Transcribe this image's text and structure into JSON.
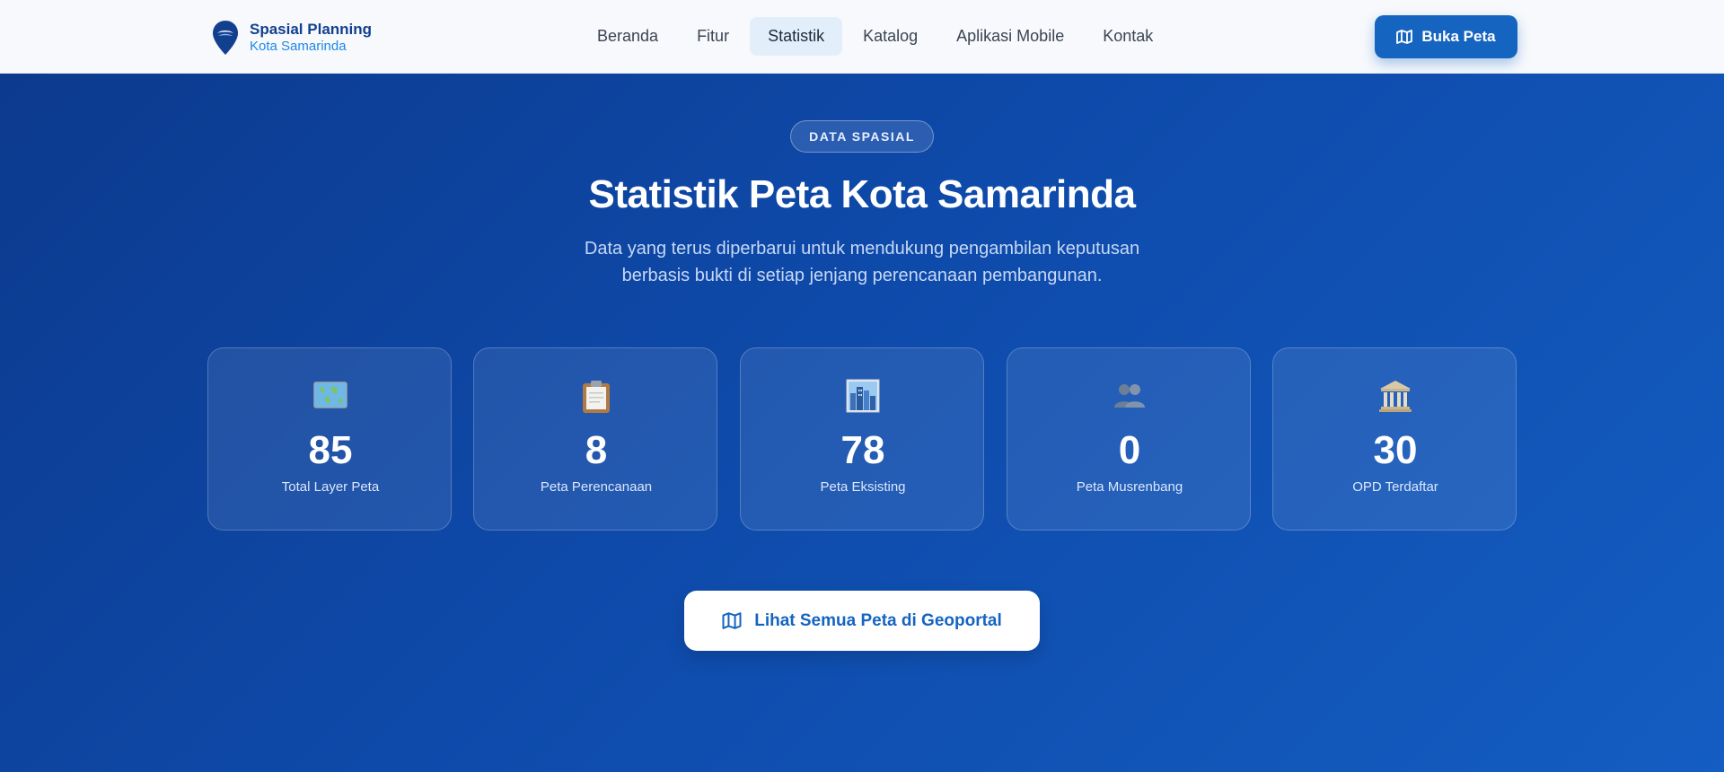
{
  "brand": {
    "title": "Spasial Planning",
    "subtitle": "Kota Samarinda",
    "icon": "map-pin-logo-icon"
  },
  "nav": {
    "items": [
      {
        "label": "Beranda",
        "active": false
      },
      {
        "label": "Fitur",
        "active": false
      },
      {
        "label": "Statistik",
        "active": true
      },
      {
        "label": "Katalog",
        "active": false
      },
      {
        "label": "Aplikasi Mobile",
        "active": false
      },
      {
        "label": "Kontak",
        "active": false
      }
    ],
    "cta_label": "Buka Peta",
    "cta_icon": "map-icon"
  },
  "hero": {
    "badge": "DATA SPASIAL",
    "title": "Statistik Peta Kota Samarinda",
    "description_line1": "Data yang terus diperbarui untuk mendukung pengambilan keputusan",
    "description_line2": "berbasis bukti di setiap jenjang perencanaan pembangunan."
  },
  "stats": [
    {
      "icon": "world-map-icon",
      "value": "85",
      "label": "Total Layer Peta"
    },
    {
      "icon": "clipboard-icon",
      "value": "8",
      "label": "Peta Perencanaan"
    },
    {
      "icon": "cityscape-icon",
      "value": "78",
      "label": "Peta Eksisting"
    },
    {
      "icon": "people-icon",
      "value": "0",
      "label": "Peta Musrenbang"
    },
    {
      "icon": "government-building-icon",
      "value": "30",
      "label": "OPD Terdaftar"
    }
  ],
  "geoportal_button": {
    "label": "Lihat Semua Peta di Geoportal",
    "icon": "map-icon"
  },
  "colors": {
    "primary": "#1565c0",
    "hero_dark": "#0c3a8e",
    "brand_text": "#12408f",
    "brand_sub": "#1e88e5"
  }
}
